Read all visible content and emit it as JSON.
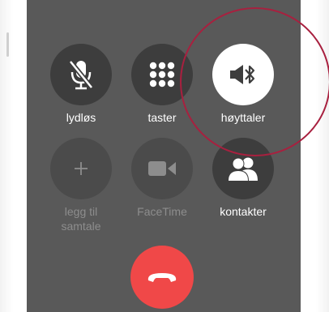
{
  "call_controls": {
    "mute": {
      "label": "lydløs",
      "icon": "microphone-muted-icon"
    },
    "keypad": {
      "label": "taster",
      "icon": "keypad-icon"
    },
    "speaker": {
      "label": "høyttaler",
      "icon": "speaker-bluetooth-icon",
      "active": true
    },
    "add_call": {
      "label_line1": "legg til",
      "label_line2": "samtale",
      "icon": "plus-icon",
      "enabled": false
    },
    "facetime": {
      "label": "FaceTime",
      "icon": "video-camera-icon",
      "enabled": false
    },
    "contacts": {
      "label": "kontakter",
      "icon": "contacts-icon"
    },
    "end_call": {
      "icon": "end-call-icon"
    }
  },
  "colors": {
    "screen_background": "#595959",
    "button_background": "#3d3d3d",
    "active_button": "#ffffff",
    "end_call": "#f04848",
    "highlight_ring": "#a8203f"
  }
}
